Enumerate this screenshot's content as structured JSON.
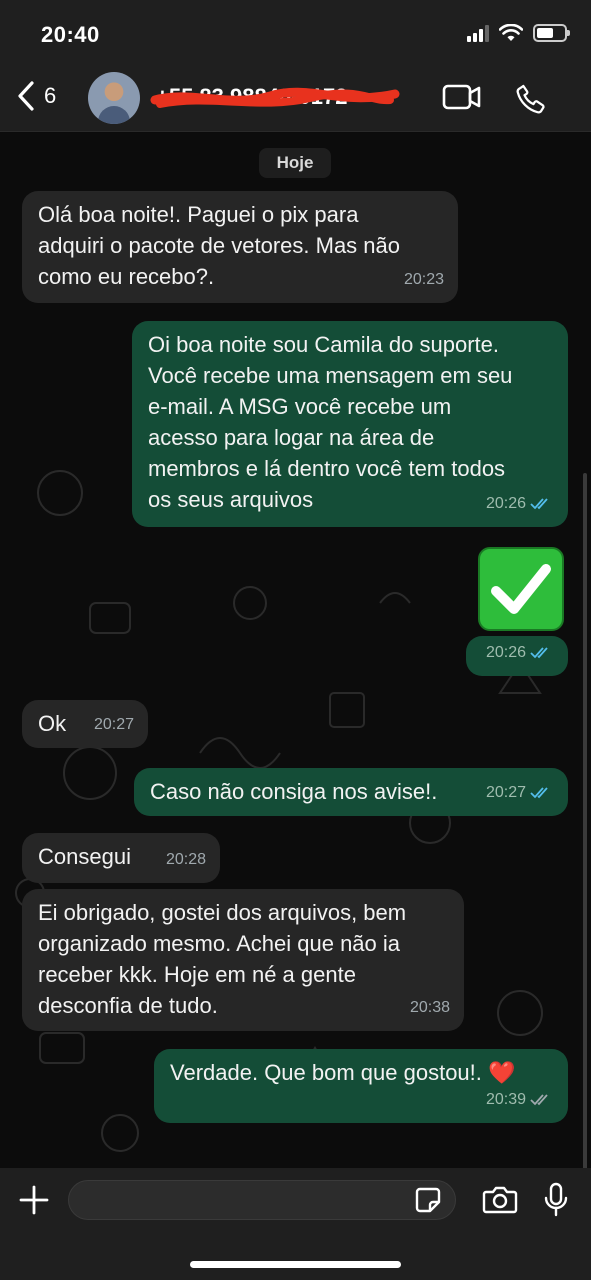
{
  "status": {
    "time": "20:40"
  },
  "header": {
    "back_count": "6",
    "contact_name": "+55 83 98846-0172"
  },
  "chat": {
    "date_chip": "Hoje",
    "messages": [
      {
        "dir": "in",
        "text": "Olá boa noite!. Paguei o pix para\nadquiri o pacote de vetores. Mas não\ncomo eu recebo?.",
        "time": "20:23"
      },
      {
        "dir": "out",
        "text": "Oi boa noite sou Camila do suporte.\nVocê recebe uma mensagem em seu\ne-mail. A MSG você recebe um\nacesso para logar na área de\nmembros e lá dentro você tem todos\nos seus arquivos",
        "time": "20:26",
        "ticks": "read"
      },
      {
        "dir": "out",
        "text": "",
        "emoji": "check-mark-button",
        "time": "20:26",
        "ticks": "read"
      },
      {
        "dir": "in",
        "text": "Ok",
        "time": "20:27"
      },
      {
        "dir": "out",
        "text": "Caso não consiga nos avise!.",
        "time": "20:27",
        "ticks": "read"
      },
      {
        "dir": "in",
        "text": "Consegui",
        "time": "20:28"
      },
      {
        "dir": "in",
        "text": "Ei obrigado, gostei dos arquivos, bem\norganizado mesmo. Achei que não ia\nreceber kkk. Hoje em né a gente\ndesconfia de tudo.",
        "time": "20:38"
      },
      {
        "dir": "out",
        "text": "Verdade. Que bom que gostou!. ❤️",
        "time": "20:39",
        "ticks": "delivered"
      }
    ]
  },
  "input": {
    "placeholder": ""
  },
  "colors": {
    "incoming_bubble": "#262626",
    "outgoing_bubble": "#144d37",
    "read_ticks": "#53bdeb",
    "delivered_ticks": "#a0a9ae"
  }
}
